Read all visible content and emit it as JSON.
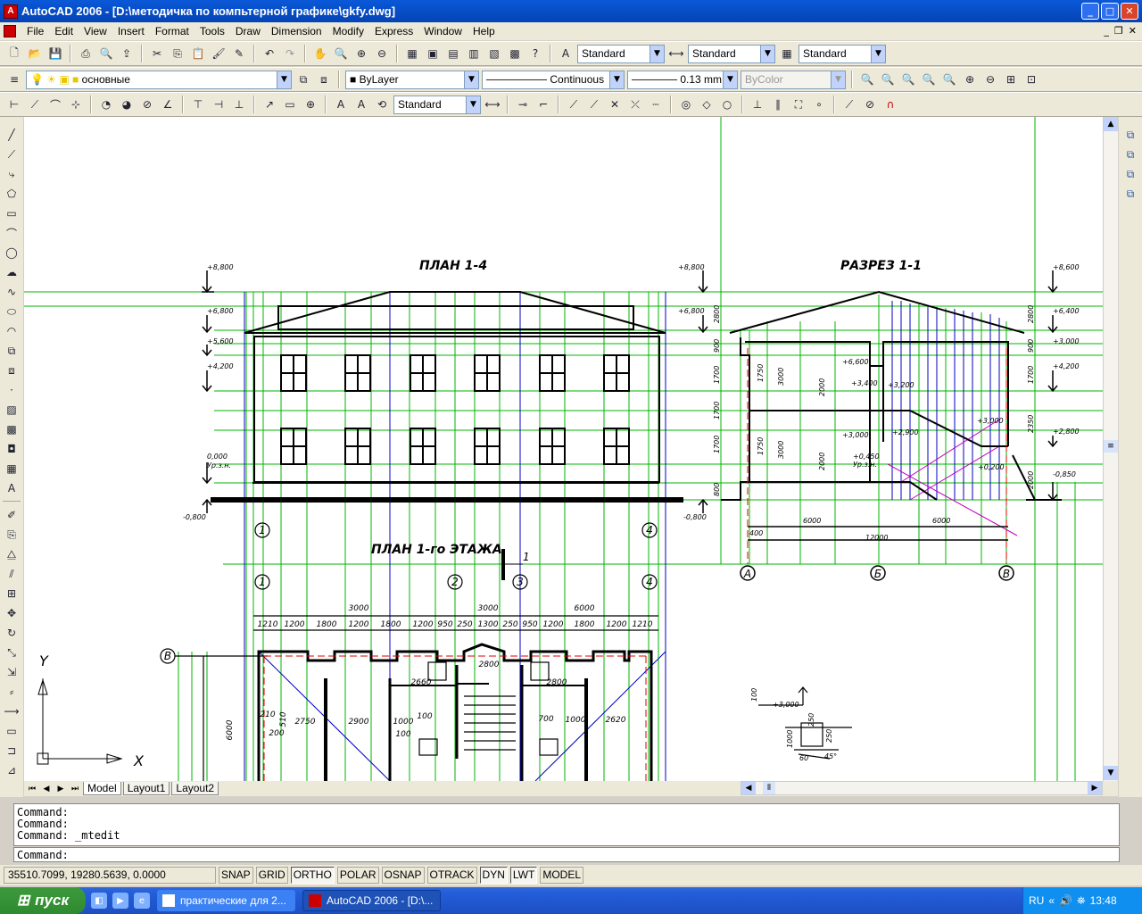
{
  "titlebar": {
    "title": "AutoCAD 2006 - [D:\\методичка по компьтерной графике\\gkfy.dwg]",
    "min": "_",
    "max": "□",
    "close": "✕"
  },
  "menu": [
    "File",
    "Edit",
    "View",
    "Insert",
    "Format",
    "Tools",
    "Draw",
    "Dimension",
    "Modify",
    "Express",
    "Window",
    "Help"
  ],
  "mdi": {
    "min": "_",
    "restore": "❐",
    "close": "✕"
  },
  "toolbar1": {
    "textstyle": "Standard",
    "dimstyle": "Standard",
    "tablestyle": "Standard"
  },
  "toolbar2": {
    "layer": "основные",
    "color": "ByLayer",
    "linetype": "Continuous",
    "lineweight": "0.13 mm",
    "plotstyle": "ByColor"
  },
  "toolbar3": {
    "dimstyle": "Standard"
  },
  "drawing": {
    "titles": {
      "facade": "ПЛАН 1-4",
      "section": "РАЗРЕЗ 1-1",
      "plan": "ПЛАН 1-го ЭТАЖА"
    },
    "section_mark": "1",
    "axes": {
      "a1": "1",
      "a4": "4",
      "a2": "2",
      "a3": "3",
      "A": "А",
      "B": "Б",
      "V": "В"
    },
    "levels": [
      "+8,800",
      "+6,800",
      "+5,600",
      "+4,200",
      "0,000",
      "-0,800",
      "+3,000",
      "+2,900",
      "+8,600",
      "+6,400",
      "+2,800",
      "-0,850"
    ],
    "level_note": "Ур.з.н.",
    "plan_dims_top": [
      "3000",
      "3000",
      "6000"
    ],
    "plan_dims_bottom": [
      "1210",
      "1200",
      "1800",
      "1200",
      "1800",
      "1200",
      "950",
      "250",
      "1300",
      "250",
      "950",
      "1200",
      "1800",
      "1200",
      "1210"
    ],
    "plan_rooms": [
      "2800",
      "2660",
      "2800",
      "2750",
      "2900",
      "2620",
      "1000",
      "1000",
      "100",
      "700",
      "100",
      "200",
      "510",
      "210",
      "6000"
    ],
    "section_dims": [
      "2800",
      "900",
      "1700",
      "1700",
      "1700",
      "900",
      "800",
      "6000",
      "6000",
      "12000",
      "400",
      "3000",
      "3000",
      "2000",
      "2000",
      "1750",
      "1750",
      "2350",
      "2000"
    ],
    "section_levels": [
      "+6,600",
      "+3,400",
      "+3,000",
      "+3,200",
      "+2,900",
      "+3,000",
      "+0,450",
      "+0,200"
    ],
    "detail": {
      "a": "100",
      "b": "+3,000",
      "c": "1000",
      "d": "250",
      "e": "250",
      "f": "60",
      "g": "45°"
    },
    "ucs": {
      "y": "Y",
      "x": "X"
    }
  },
  "tabs": [
    "Model",
    "Layout1",
    "Layout2"
  ],
  "command_history": [
    "Command:",
    "Command:",
    "Command:  _mtedit"
  ],
  "command_prompt": "Command:",
  "status": {
    "coords": "35510.7099, 19280.5639, 0.0000",
    "buttons": [
      "SNAP",
      "GRID",
      "ORTHO",
      "POLAR",
      "OSNAP",
      "OTRACK",
      "DYN",
      "LWT",
      "MODEL"
    ]
  },
  "taskbar": {
    "start": "пуск",
    "tasks": [
      "практические для 2...",
      "AutoCAD 2006 - [D:\\..."
    ],
    "lang": "RU",
    "time": "13:48"
  },
  "colors": {
    "green": "#00b400",
    "blue": "#0000c0",
    "red": "#e00000",
    "magenta": "#c000c0",
    "title_blue": "#0543b5"
  }
}
